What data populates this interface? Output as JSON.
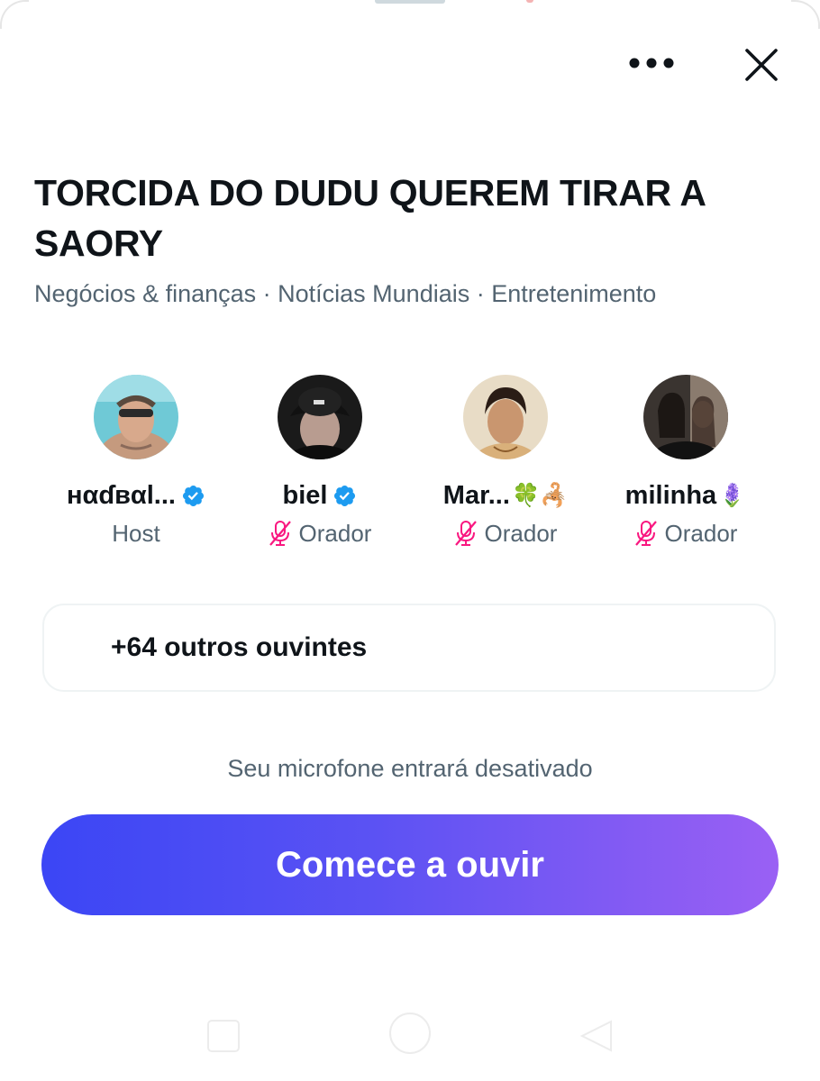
{
  "space": {
    "title": "TORCIDA DO DUDU QUEREM TIRAR A SAORY",
    "topics": "Negócios & finanças · Notícias Mundiais · Entretenimento"
  },
  "header": {
    "more_icon": "more-horizontal-icon",
    "close_icon": "close-icon"
  },
  "speakers": [
    {
      "name": "нαɗвαl...",
      "verified": true,
      "name_emoji": "",
      "role": "Host",
      "muted": false
    },
    {
      "name": "biel",
      "verified": true,
      "name_emoji": "",
      "role": "Orador",
      "muted": true
    },
    {
      "name": "Mar...",
      "verified": false,
      "name_emoji": "🍀🦂",
      "role": "Orador",
      "muted": true
    },
    {
      "name": "milinha",
      "verified": false,
      "name_emoji": "🪻",
      "role": "Orador",
      "muted": true
    }
  ],
  "listeners": {
    "label": "+64 outros ouvintes"
  },
  "mic_note": "Seu microfone entrará desativado",
  "listen_button": {
    "label": "Comece a ouvir"
  },
  "colors": {
    "verified_blue": "#1d9bf0",
    "muted_mic_pink": "#f91880",
    "button_gradient_start": "#3b46f5",
    "button_gradient_end": "#9a60f4",
    "secondary_text": "#536471"
  }
}
